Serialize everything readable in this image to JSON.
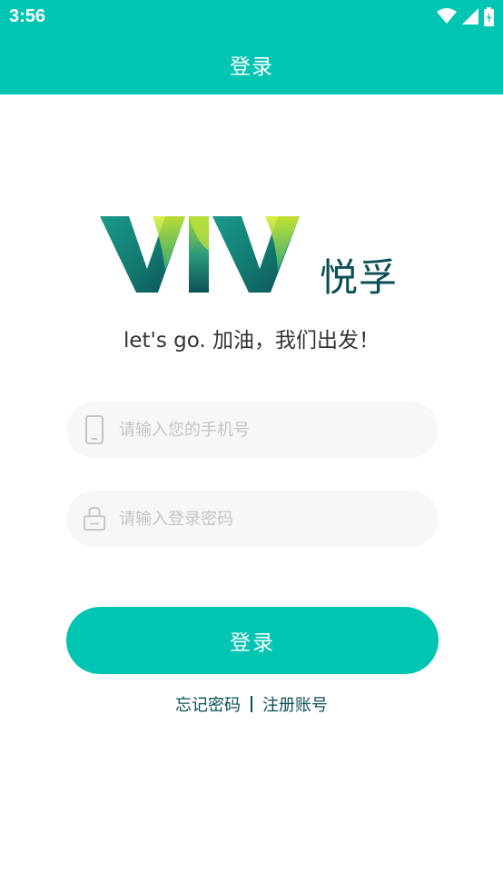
{
  "status_bar": {
    "time": "3:56",
    "icons": [
      "wifi-icon",
      "cellular-signal-icon",
      "battery-charging-icon"
    ]
  },
  "header": {
    "title": "登录"
  },
  "logo": {
    "wordmark": "VIV",
    "brand_name": "悦孚"
  },
  "slogan": "let's go. 加油，我们出发！",
  "form": {
    "phone": {
      "icon": "phone-icon",
      "placeholder": "请输入您的手机号",
      "value": ""
    },
    "password": {
      "icon": "lock-icon",
      "placeholder": "请输入登录密码",
      "value": ""
    },
    "login_label": "登录"
  },
  "links": {
    "forgot_password": "忘记密码",
    "register": "注册账号"
  },
  "colors": {
    "accent": "#00c5b2",
    "brand_dark": "#0a4f55",
    "field_bg": "#f7f7f7",
    "placeholder": "#c4c4c4"
  }
}
